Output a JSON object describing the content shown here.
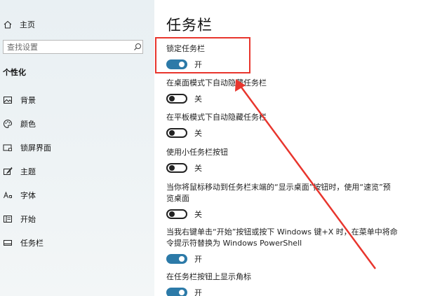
{
  "sidebar": {
    "home": "主页",
    "search_placeholder": "查找设置",
    "section": "个性化",
    "items": [
      {
        "label": "背景",
        "icon": "image-icon"
      },
      {
        "label": "颜色",
        "icon": "palette-icon"
      },
      {
        "label": "锁屏界面",
        "icon": "lock-screen-icon"
      },
      {
        "label": "主题",
        "icon": "theme-brush-icon"
      },
      {
        "label": "字体",
        "icon": "font-icon"
      },
      {
        "label": "开始",
        "icon": "start-menu-icon"
      },
      {
        "label": "任务栏",
        "icon": "taskbar-icon"
      }
    ]
  },
  "main": {
    "title": "任务栏",
    "settings": [
      {
        "label": "锁定任务栏",
        "state": "开",
        "on": true
      },
      {
        "label": "在桌面模式下自动隐藏任务栏",
        "state": "关",
        "on": false
      },
      {
        "label": "在平板模式下自动隐藏任务栏",
        "state": "关",
        "on": false
      },
      {
        "label": "使用小任务栏按钮",
        "state": "关",
        "on": false
      },
      {
        "label": "当你将鼠标移动到任务栏末端的“显示桌面”按钮时，使用“速览”预览桌面",
        "state": "关",
        "on": false
      },
      {
        "label": "当我右键单击“开始”按钮或按下 Windows 键+X 时，在菜单中将命令提示符替换为 Windows PowerShell",
        "state": "开",
        "on": true
      },
      {
        "label": "在任务栏按钮上显示角标",
        "state": "开",
        "on": true
      }
    ]
  },
  "colors": {
    "toggle_on": "#2c7aa8",
    "annotation_red": "#e8352d"
  }
}
